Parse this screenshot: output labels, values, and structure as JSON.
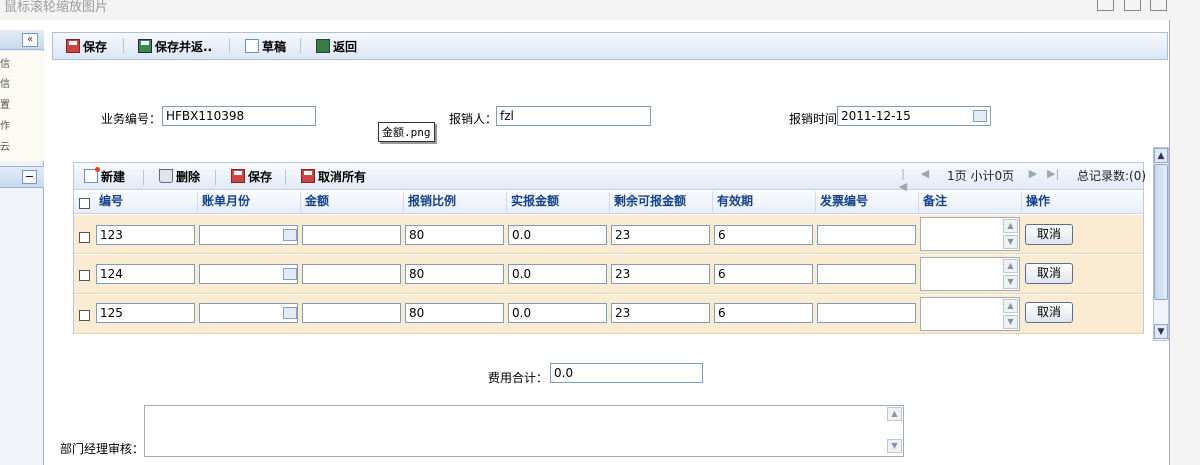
{
  "window": {
    "title": "鼠标滚轮缩放图片"
  },
  "sidebar": {
    "collapse_label": "«",
    "items": [
      "信",
      "信",
      "置",
      "作",
      "云"
    ],
    "toggle_label": "−"
  },
  "toolbar": {
    "save": "保存",
    "save_and_new": "保存并返..",
    "draft": "草稿",
    "back": "返回"
  },
  "form": {
    "biz_no_label": "业务编号：",
    "biz_no_value": "HFBX110398",
    "reporter_label": "报销人：",
    "reporter_value": "fzl",
    "date_label": "报销时间",
    "date_value": "2011-12-15",
    "tooltip": "金额.png"
  },
  "grid": {
    "toolbar": {
      "new": "新建",
      "delete": "删除",
      "save": "保存",
      "cancel_all": "取消所有"
    },
    "pager": {
      "page_text": "1页 小计0页",
      "total_text": "总记录数:(0)"
    },
    "columns": [
      "编号",
      "账单月份",
      "金额",
      "报销比例",
      "实报金额",
      "剩余可报金额",
      "有效期",
      "发票编号",
      "备注",
      "操作"
    ],
    "rows": [
      {
        "no": "123",
        "month": "",
        "amount": "",
        "ratio": "80",
        "actual": "0.0",
        "remaining": "23",
        "validity": "6",
        "invoice": "",
        "action": "取消"
      },
      {
        "no": "124",
        "month": "",
        "amount": "",
        "ratio": "80",
        "actual": "0.0",
        "remaining": "23",
        "validity": "6",
        "invoice": "",
        "action": "取消"
      },
      {
        "no": "125",
        "month": "",
        "amount": "",
        "ratio": "80",
        "actual": "0.0",
        "remaining": "23",
        "validity": "6",
        "invoice": "",
        "action": "取消"
      }
    ]
  },
  "summary": {
    "total_label": "费用合计：",
    "total_value": "0.0"
  },
  "approval": {
    "dept_manager_label": "部门经理审核："
  },
  "colors": {
    "header_text": "#15428b",
    "row_bg": "#faebd2",
    "toolbar_bg": "#dce6f4"
  }
}
